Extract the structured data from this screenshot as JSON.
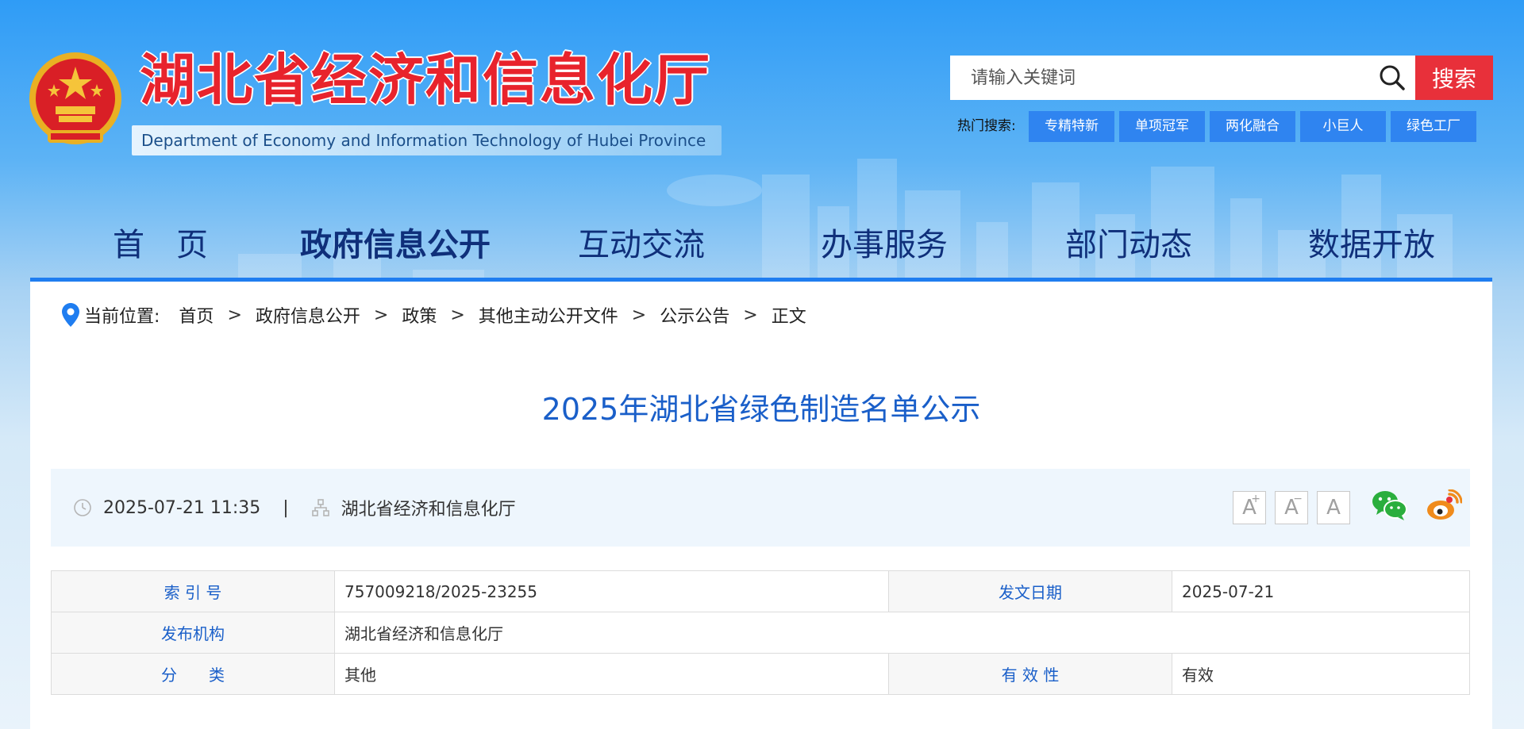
{
  "header": {
    "title": "湖北省经济和信息化厅",
    "subtitle": "Department of Economy and Information Technology of Hubei Province",
    "logo_icon": "national-emblem-icon"
  },
  "search": {
    "placeholder": "请输入关键词",
    "button_label": "搜索",
    "hot_label": "热门搜索:",
    "hot_tags": [
      "专精特新",
      "单项冠军",
      "两化融合",
      "小巨人",
      "绿色工厂"
    ]
  },
  "nav": {
    "items": [
      "首　页",
      "政府信息公开",
      "互动交流",
      "办事服务",
      "部门动态",
      "数据开放"
    ]
  },
  "breadcrumb": {
    "current_label": "当前位置:",
    "items": [
      "首页",
      "政府信息公开",
      "政策",
      "其他主动公开文件",
      "公示公告",
      "正文"
    ],
    "separator": ">"
  },
  "article": {
    "title": "2025年湖北省绿色制造名单公示",
    "date": "2025-07-21 11:35",
    "divider": "|",
    "source": "湖北省经济和信息化厅",
    "font_buttons": [
      "A",
      "A",
      "A"
    ],
    "font_sups": [
      "+",
      "−",
      ""
    ]
  },
  "info": {
    "index_label": "索 引 号",
    "index_value": "757009218/2025-23255",
    "date_label": "发文日期",
    "date_value": "2025-07-21",
    "org_label": "发布机构",
    "org_value": "湖北省经济和信息化厅",
    "category_label": "分　　类",
    "category_value": "其他",
    "validity_label": "有 效 性",
    "validity_value": "有效"
  },
  "colors": {
    "accent": "#1f7df0",
    "title_red": "#e8232c",
    "search_red": "#e8303a",
    "tag_blue": "#2f84f0",
    "wechat_green": "#2aae3d",
    "weibo_orange": "#f08b1c"
  }
}
